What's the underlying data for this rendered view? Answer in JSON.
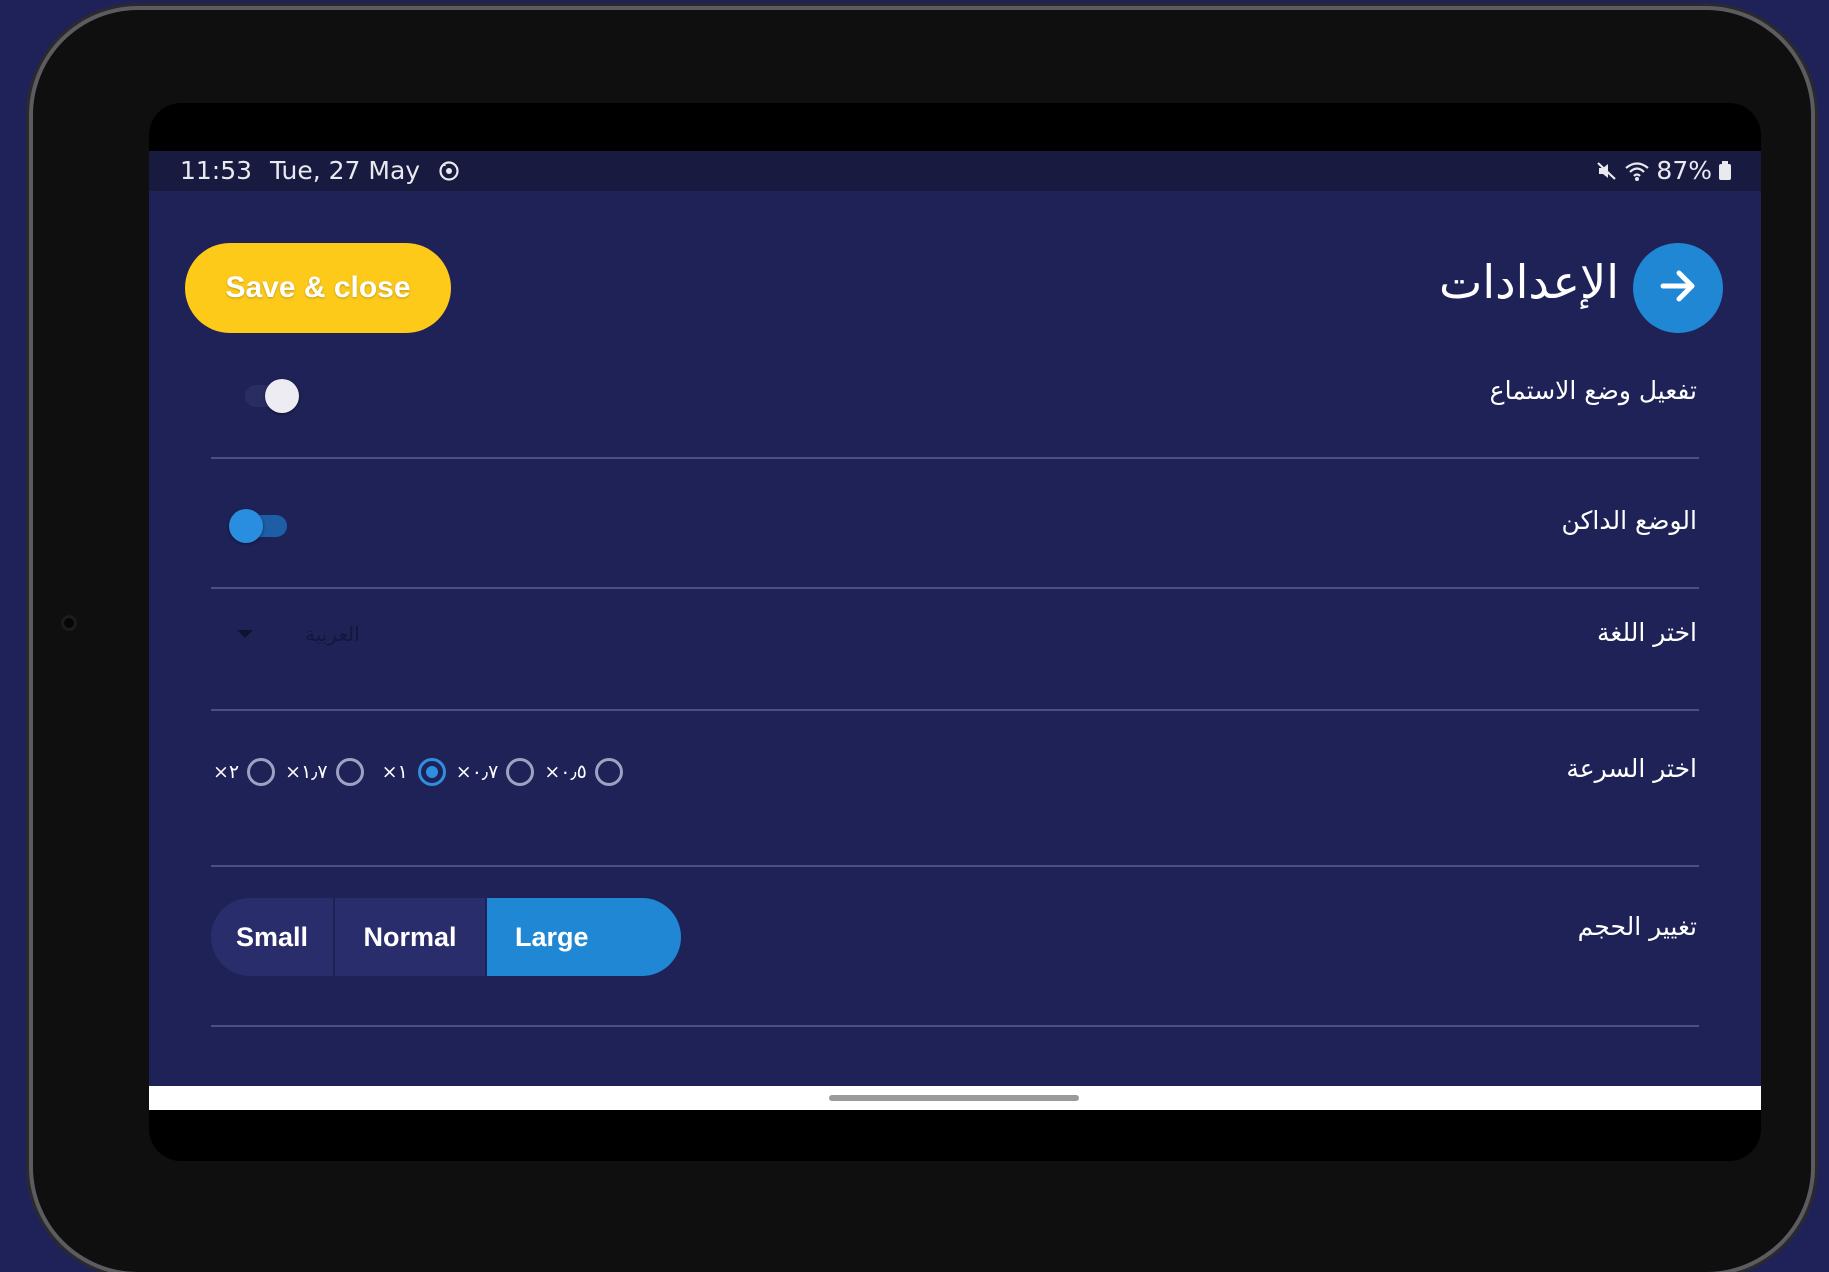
{
  "status_bar": {
    "time": "11:53",
    "date": "Tue, 27 May",
    "battery": "87%"
  },
  "header": {
    "title": "الإعدادات",
    "save_label": "Save & close",
    "back_icon": "arrow-right-icon"
  },
  "settings": {
    "listen_mode": {
      "label": "تفعيل وضع الاستماع",
      "on": false
    },
    "dark_mode": {
      "label": "الوضع الداكن",
      "on": true
    },
    "language": {
      "label": "اختر اللغة",
      "value": "العربية"
    },
    "speed": {
      "label": "اختر السرعة",
      "options": [
        {
          "label": "×٢",
          "checked": false
        },
        {
          "label": "×١٫٧",
          "checked": false
        },
        {
          "label": "×١",
          "checked": true
        },
        {
          "label": "×٠٫٧",
          "checked": false
        },
        {
          "label": "×٠٫٥",
          "checked": false
        }
      ]
    },
    "size": {
      "label": "تغيير الحجم",
      "options": [
        "Small",
        "Normal",
        "Large"
      ],
      "selected": "Large"
    }
  },
  "colors": {
    "background": "#1f2257",
    "accent_yellow": "#fdca1a",
    "accent_blue": "#1f87d4"
  }
}
